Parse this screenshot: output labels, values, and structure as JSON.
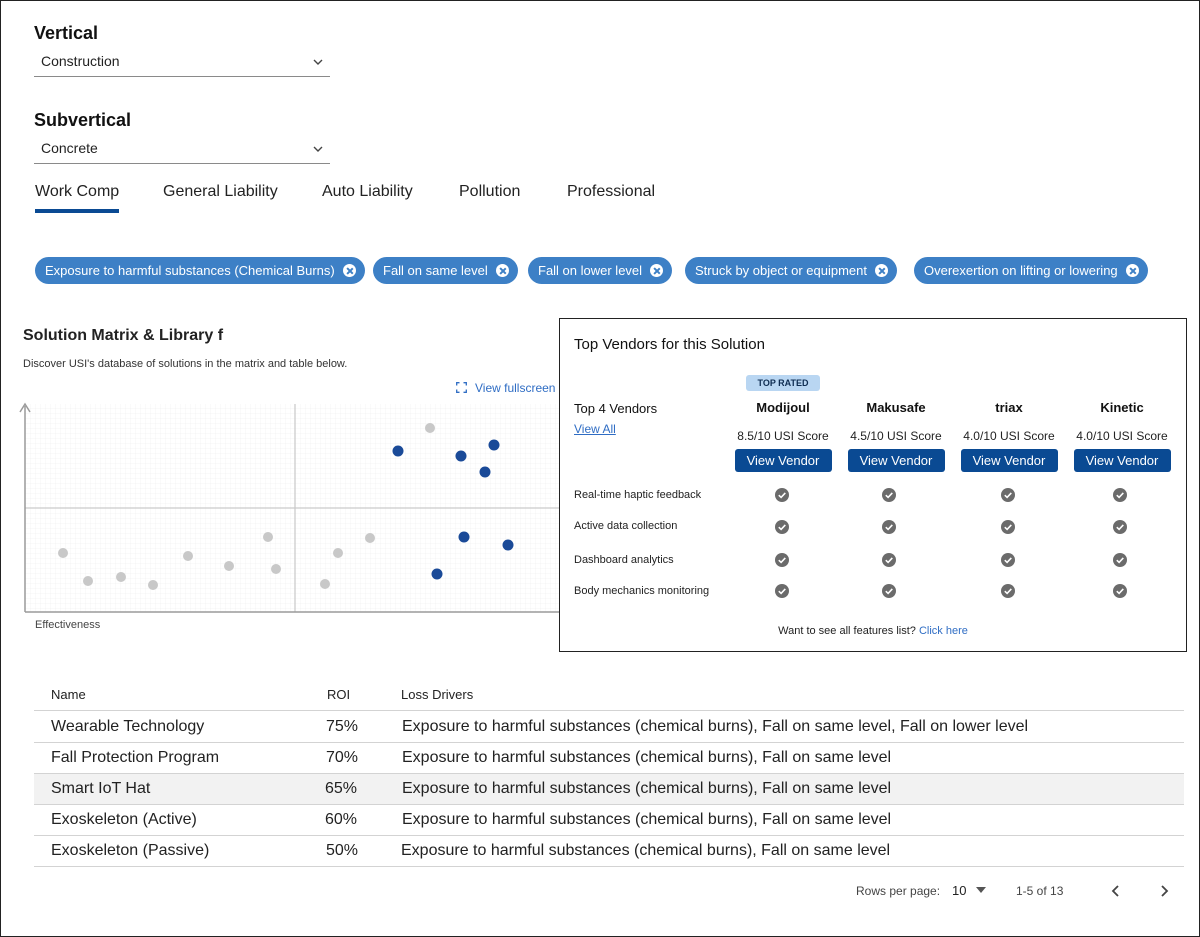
{
  "filters": {
    "vertical": {
      "label": "Vertical",
      "value": "Construction"
    },
    "subvertical": {
      "label": "Subvertical",
      "value": "Concrete"
    }
  },
  "tabs": [
    {
      "label": "Work Comp",
      "active": true
    },
    {
      "label": "General Liability",
      "active": false
    },
    {
      "label": "Auto Liability",
      "active": false
    },
    {
      "label": "Pollution",
      "active": false
    },
    {
      "label": "Professional",
      "active": false
    }
  ],
  "chips": [
    "Exposure to harmful substances (Chemical Burns)",
    "Fall on same level",
    "Fall on lower level",
    "Struck by object or equipment",
    "Overexertion on lifting or lowering"
  ],
  "solution_matrix": {
    "title": "Solution Matrix & Library f",
    "subtitle": "Discover USI's database of solutions in the matrix and table below.",
    "fullscreen_label": "View fullscreen",
    "x_axis_label": "Effectiveness",
    "colors": {
      "selected": "#1a4a98",
      "other": "#c8c8c8"
    },
    "points_note": "scatter of solutions; blue = selected"
  },
  "vendor_panel": {
    "title": "Top Vendors for this Solution",
    "top_label": "Top 4 Vendors",
    "view_all": "View All",
    "badge": "TOP RATED",
    "vendors": [
      {
        "name": "Modijoul",
        "score": "8.5/10 USI Score",
        "button": "View Vendor"
      },
      {
        "name": "Makusafe",
        "score": "4.5/10 USI Score",
        "button": "View Vendor"
      },
      {
        "name": "triax",
        "score": "4.0/10 USI Score",
        "button": "View Vendor"
      },
      {
        "name": "Kinetic",
        "score": "4.0/10 USI Score",
        "button": "View Vendor"
      }
    ],
    "features": [
      "Real-time haptic feedback",
      "Active data collection",
      "Dashboard analytics",
      "Body mechanics monitoring"
    ],
    "footer_text": "Want to see all features list?",
    "footer_link": "Click here"
  },
  "table": {
    "headers": {
      "name": "Name",
      "roi": "ROI",
      "drivers": "Loss Drivers"
    },
    "rows": [
      {
        "name": "Wearable Technology",
        "roi": "75%",
        "drivers": "Exposure to harmful substances (chemical burns), Fall on same level, Fall on lower level"
      },
      {
        "name": "Fall Protection Program",
        "roi": "70%",
        "drivers": "Exposure to harmful substances (chemical burns), Fall on same level"
      },
      {
        "name": "Smart IoT Hat",
        "roi": "65%",
        "drivers": "Exposure to harmful substances (chemical burns), Fall on same level"
      },
      {
        "name": "Exoskeleton (Active)",
        "roi": "60%",
        "drivers": "Exposure to harmful substances (chemical burns), Fall on same level"
      },
      {
        "name": "Exoskeleton (Passive)",
        "roi": "50%",
        "drivers": "Exposure to harmful substances (chemical burns), Fall on same level"
      }
    ]
  },
  "pagination": {
    "rows_per_page_label": "Rows per page:",
    "rows_per_page": "10",
    "range": "1-5 of 13"
  }
}
